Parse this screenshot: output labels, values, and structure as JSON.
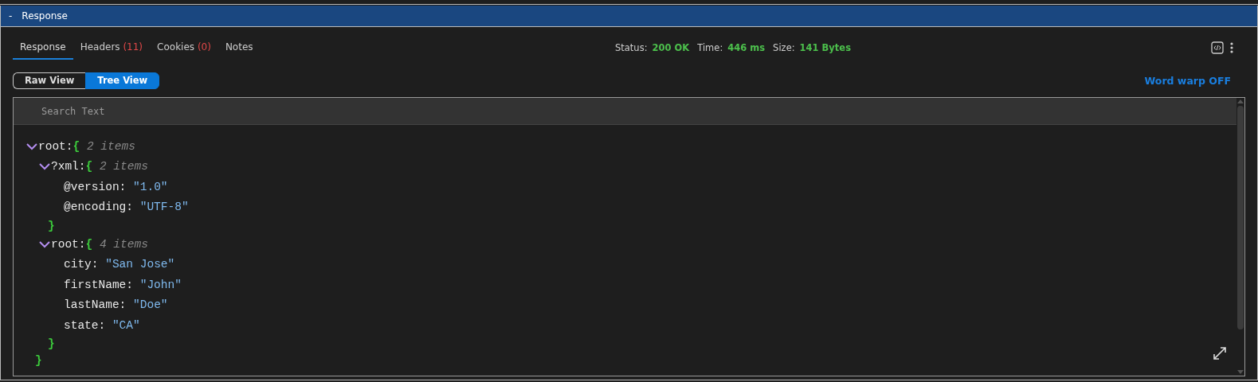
{
  "panel": {
    "collapse_glyph": "-",
    "title": "Response",
    "expanded": true
  },
  "tabs": [
    {
      "label": "Response",
      "selected": true
    },
    {
      "label": "Headers",
      "count": "(11)",
      "selected": false
    },
    {
      "label": "Cookies",
      "count": "(0)",
      "selected": false
    },
    {
      "label": "Notes",
      "selected": false
    }
  ],
  "status": [
    {
      "label": "Status:",
      "value": "200 OK"
    },
    {
      "label": "Time:",
      "value": "446 ms"
    },
    {
      "label": "Size:",
      "value": "141 Bytes"
    }
  ],
  "views": [
    {
      "label": "Raw View",
      "selected": false
    },
    {
      "label": "Tree View",
      "selected": true
    }
  ],
  "word_wrap_link": "Word warp OFF",
  "search": {
    "placeholder": "Search Text"
  },
  "tree": [
    {
      "key": "root:",
      "open": "{",
      "count": "2 items",
      "close": "}",
      "expanded": true,
      "children": [
        {
          "key": "?xml:",
          "open": "{",
          "count": "2 items",
          "close": "}",
          "expanded": true,
          "children": [
            {
              "key": "@version:",
              "value": "\"1.0\""
            },
            {
              "key": "@encoding:",
              "value": "\"UTF-8\""
            }
          ]
        },
        {
          "key": "root:",
          "open": "{",
          "count": "4 items",
          "close": "}",
          "expanded": true,
          "children": [
            {
              "key": "city:",
              "value": "\"San Jose\""
            },
            {
              "key": "firstName:",
              "value": "\"John\""
            },
            {
              "key": "lastName:",
              "value": "\"Doe\""
            },
            {
              "key": "state:",
              "value": "\"CA\""
            }
          ]
        }
      ]
    }
  ]
}
